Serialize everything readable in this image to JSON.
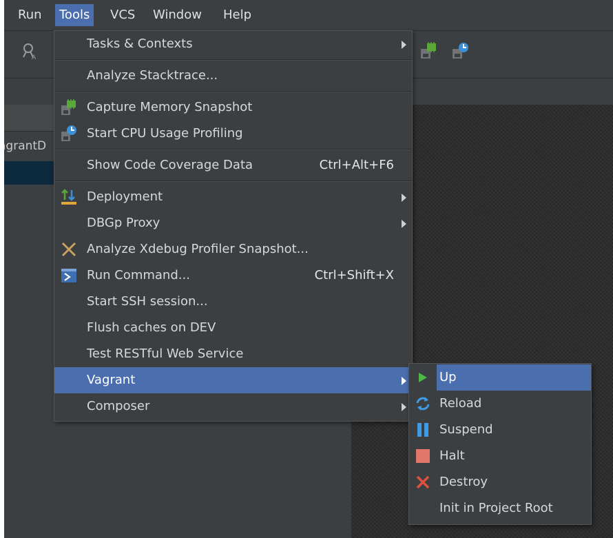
{
  "menubar": {
    "items": [
      "Run",
      "Tools",
      "VCS",
      "Window",
      "Help"
    ],
    "active": "Tools"
  },
  "project": {
    "label": "agrantD"
  },
  "tools_menu": {
    "items": [
      {
        "label": "Tasks & Contexts",
        "submenu": true
      },
      {
        "label": "Analyze Stacktrace..."
      },
      {
        "label": "Capture Memory Snapshot",
        "icon": "memory-snapshot-icon"
      },
      {
        "label": "Start CPU Usage Profiling",
        "icon": "cpu-profiling-icon"
      },
      {
        "label": "Show Code Coverage Data",
        "shortcut": "Ctrl+Alt+F6"
      },
      {
        "label": "Deployment",
        "submenu": true,
        "icon": "deployment-icon"
      },
      {
        "label": "DBGp Proxy",
        "submenu": true
      },
      {
        "label": "Analyze Xdebug Profiler Snapshot...",
        "icon": "xdebug-icon"
      },
      {
        "label": "Run Command...",
        "shortcut": "Ctrl+Shift+X",
        "icon": "terminal-icon"
      },
      {
        "label": "Start SSH session..."
      },
      {
        "label": "Flush caches on DEV"
      },
      {
        "label": "Test RESTful Web Service"
      },
      {
        "label": "Vagrant",
        "submenu": true,
        "highlighted": true
      },
      {
        "label": "Composer",
        "submenu": true
      }
    ]
  },
  "vagrant_submenu": {
    "items": [
      {
        "label": "Up",
        "icon": "play-icon",
        "highlighted": true
      },
      {
        "label": "Reload",
        "icon": "reload-icon"
      },
      {
        "label": "Suspend",
        "icon": "pause-icon"
      },
      {
        "label": "Halt",
        "icon": "stop-icon"
      },
      {
        "label": "Destroy",
        "icon": "destroy-icon"
      },
      {
        "label": "Init in Project Root"
      }
    ]
  },
  "colors": {
    "background": "#3c3f41",
    "highlight": "#4b6eaf",
    "editor": "#2a2a2a",
    "selection": "#0d293e"
  }
}
